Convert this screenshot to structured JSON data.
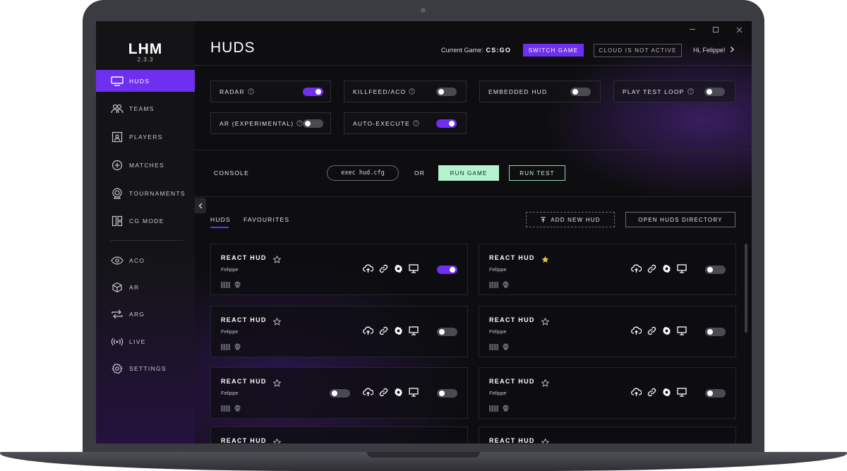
{
  "app": {
    "logo": "LHM",
    "version": "2.3.3"
  },
  "sidebar": {
    "items": [
      {
        "label": "HUDS",
        "icon": "monitor-icon",
        "active": true
      },
      {
        "label": "TEAMS",
        "icon": "users-icon"
      },
      {
        "label": "PLAYERS",
        "icon": "player-card-icon"
      },
      {
        "label": "MATCHES",
        "icon": "plus-circle-icon"
      },
      {
        "label": "TOURNAMENTS",
        "icon": "trophy-icon"
      },
      {
        "label": "CG MODE",
        "icon": "layout-icon"
      },
      {
        "label": "ACO",
        "icon": "eye-icon"
      },
      {
        "label": "AR",
        "icon": "cube-icon"
      },
      {
        "label": "ARG",
        "icon": "repeat-icon"
      },
      {
        "label": "LIVE",
        "icon": "broadcast-icon"
      },
      {
        "label": "SETTINGS",
        "icon": "gear-icon"
      }
    ]
  },
  "header": {
    "title": "HUDS",
    "current_game_label": "Current Game:",
    "current_game_value": "CS:GO",
    "switch_game": "SWITCH GAME",
    "cloud_status": "CLOUD IS NOT ACTIVE",
    "greeting": "Hi, Felippe!"
  },
  "toggles": [
    {
      "label": "RADAR",
      "help": true,
      "on": true
    },
    {
      "label": "KILLFEED/ACO",
      "help": true,
      "on": false
    },
    {
      "label": "EMBEDDED HUD",
      "help": false,
      "on": false
    },
    {
      "label": "PLAY TEST LOOP",
      "help": true,
      "on": false
    },
    {
      "label": "AR (EXPERIMENTAL)",
      "help": true,
      "on": false
    },
    {
      "label": "AUTO-EXECUTE",
      "help": true,
      "on": true
    }
  ],
  "console": {
    "label": "CONSOLE",
    "command": "exec hud.cfg",
    "or": "OR",
    "run_game": "RUN GAME",
    "run_test": "RUN TEST"
  },
  "tabs": {
    "huds": "HUDS",
    "favourites": "FAVOURITES",
    "add_new": "ADD NEW HUD",
    "open_dir": "OPEN HUDS DIRECTORY"
  },
  "huds": [
    {
      "name": "REACT HUD",
      "author": "Felippe",
      "favourite": false,
      "on": true,
      "extra_toggle": false
    },
    {
      "name": "REACT HUD",
      "author": "Felippe",
      "favourite": true,
      "on": false,
      "extra_toggle": false
    },
    {
      "name": "REACT HUD",
      "author": "Felippe",
      "favourite": false,
      "on": false,
      "extra_toggle": false
    },
    {
      "name": "REACT HUD",
      "author": "Felippe",
      "favourite": false,
      "on": false,
      "extra_toggle": false
    },
    {
      "name": "REACT HUD",
      "author": "Felippe",
      "favourite": false,
      "on": false,
      "extra_toggle": true,
      "extra_on": false
    },
    {
      "name": "REACT HUD",
      "author": "Felippe",
      "favourite": false,
      "on": false,
      "extra_toggle": false
    },
    {
      "name": "REACT HUD",
      "author": "",
      "favourite": false,
      "on": false,
      "extra_toggle": false
    },
    {
      "name": "REACT HUD",
      "author": "",
      "favourite": false,
      "on": false,
      "extra_toggle": false
    }
  ],
  "colors": {
    "accent": "#6e2ff0",
    "run_game": "#b4f3cd",
    "favourite_star": "#f6c533"
  }
}
